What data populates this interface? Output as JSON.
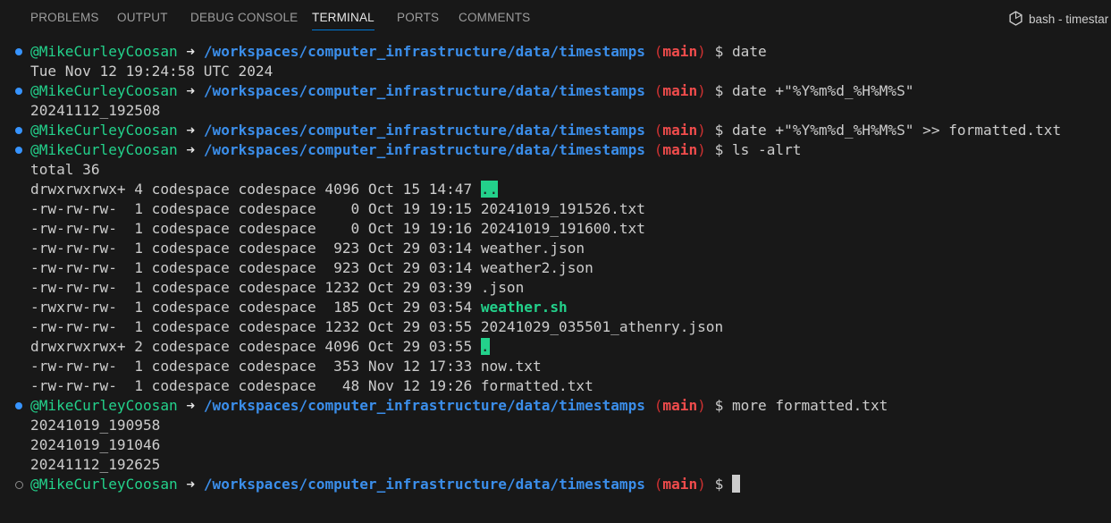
{
  "panel": {
    "tabs": [
      {
        "label": "PROBLEMS"
      },
      {
        "label": "OUTPUT"
      },
      {
        "label": "DEBUG CONSOLE"
      },
      {
        "label": "TERMINAL"
      },
      {
        "label": "PORTS"
      },
      {
        "label": "COMMENTS"
      }
    ],
    "active_tab": "TERMINAL",
    "shell_label": "bash - timestar"
  },
  "prompt": {
    "user": "@MikeCurleyCoosan",
    "arrow": "➜",
    "path": "/workspaces/computer_infrastructure/data/timestamps",
    "branch": "main",
    "symbol": "$"
  },
  "commands": {
    "c1": "date",
    "c2": "date +\"%Y%m%d_%H%M%S\"",
    "c3": "date +\"%Y%m%d_%H%M%S\" >> formatted.txt",
    "c4": "ls -alrt",
    "c5": "more formatted.txt"
  },
  "outputs": {
    "date_out": "Tue Nov 12 19:24:58 UTC 2024",
    "fmt_out": "20241112_192508",
    "total": "total 36"
  },
  "listing": [
    {
      "meta": "drwxrwxrwx+ 4 codespace codespace 4096 Oct 15 14:47 ",
      "name": ".."
    },
    {
      "meta": "-rw-rw-rw-  1 codespace codespace    0 Oct 19 19:15 ",
      "name": "20241019_191526.txt"
    },
    {
      "meta": "-rw-rw-rw-  1 codespace codespace    0 Oct 19 19:16 ",
      "name": "20241019_191600.txt"
    },
    {
      "meta": "-rw-rw-rw-  1 codespace codespace  923 Oct 29 03:14 ",
      "name": "weather.json"
    },
    {
      "meta": "-rw-rw-rw-  1 codespace codespace  923 Oct 29 03:14 ",
      "name": "weather2.json"
    },
    {
      "meta": "-rw-rw-rw-  1 codespace codespace 1232 Oct 29 03:39 ",
      "name": ".json"
    },
    {
      "meta": "-rwxrw-rw-  1 codespace codespace  185 Oct 29 03:54 ",
      "name": "weather.sh"
    },
    {
      "meta": "-rw-rw-rw-  1 codespace codespace 1232 Oct 29 03:55 ",
      "name": "20241029_035501_athenry.json"
    },
    {
      "meta": "drwxrwxrwx+ 2 codespace codespace 4096 Oct 29 03:55 ",
      "name": "."
    },
    {
      "meta": "-rw-rw-rw-  1 codespace codespace  353 Nov 12 17:33 ",
      "name": "now.txt"
    },
    {
      "meta": "-rw-rw-rw-  1 codespace codespace   48 Nov 12 19:26 ",
      "name": "formatted.txt"
    }
  ],
  "more_output": [
    "20241019_190958",
    "20241019_191046",
    "20241112_192625"
  ],
  "colors": {
    "user": "#23d18b",
    "path": "#3b8eea",
    "branch": "#f14c4c",
    "accent": "#0078d4",
    "background": "#181818"
  }
}
